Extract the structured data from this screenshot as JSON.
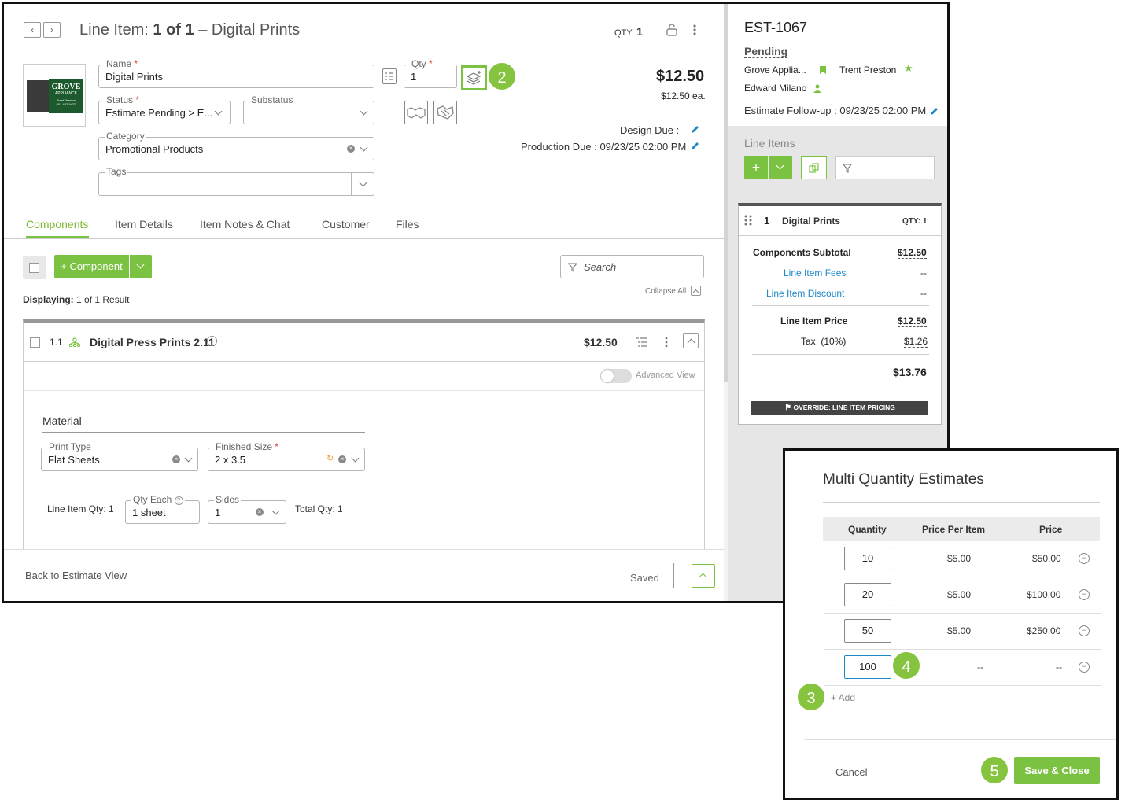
{
  "header": {
    "title_prefix": "Line Item:",
    "title_counter": "1 of 1",
    "title_dash": "–",
    "title_name": "Digital Prints",
    "qty_label": "QTY:",
    "qty_value": "1",
    "prev_icon": "chevron-left-icon",
    "next_icon": "chevron-right-icon"
  },
  "form": {
    "name": {
      "label": "Name",
      "value": "Digital Prints"
    },
    "qty": {
      "label": "Qty",
      "value": "1"
    },
    "status": {
      "label": "Status",
      "value": "Estimate Pending > E..."
    },
    "substatus": {
      "label": "Substatus",
      "value": ""
    },
    "category": {
      "label": "Category",
      "value": "Promotional Products"
    },
    "tags": {
      "label": "Tags",
      "value": ""
    },
    "required_mark": "*"
  },
  "thumbnail": {
    "brand": "GROVE",
    "sub": "APPLIANCE",
    "line1": "Trent Preston",
    "line2": "801-437-9422"
  },
  "pricing": {
    "price": "$12.50",
    "each": "$12.50 ea.",
    "design_due": "Design Due : --",
    "production_due": "Production Due : 09/23/25 02:00 PM"
  },
  "tabs": [
    "Components",
    "Item Details",
    "Item Notes & Chat",
    "Customer",
    "Files"
  ],
  "components": {
    "add_label": "+ Component",
    "search_placeholder": "Search",
    "displaying_label": "Displaying:",
    "displaying_value": "1 of 1 Result",
    "collapse_all": "Collapse All",
    "item": {
      "num": "1.1",
      "name": "Digital Press Prints 2.11",
      "price": "$12.50"
    },
    "advanced_view": "Advanced View"
  },
  "material": {
    "heading": "Material",
    "print_type": {
      "label": "Print Type",
      "value": "Flat Sheets"
    },
    "finished_size": {
      "label": "Finished Size",
      "value": "2 x 3.5"
    },
    "line_item_qty": "Line Item Qty: 1",
    "qty_each": {
      "label": "Qty Each",
      "value": "1 sheet"
    },
    "sides": {
      "label": "Sides",
      "value": "1"
    },
    "total_qty": "Total Qty: 1"
  },
  "footer": {
    "back": "Back to Estimate View",
    "saved": "Saved"
  },
  "estimate": {
    "id": "EST-1067",
    "status": "Pending",
    "company": "Grove Applia...",
    "contact": "Trent Preston",
    "salesperson": "Edward Milano",
    "followup": "Estimate Follow-up : 09/23/25 02:00 PM"
  },
  "line_items": {
    "heading": "Line Items",
    "card": {
      "num": "1",
      "name": "Digital Prints",
      "qty": "QTY: 1"
    },
    "rows": [
      {
        "label": "Components Subtotal",
        "value": "$12.50"
      },
      {
        "label": "Line Item Fees",
        "value": "--"
      },
      {
        "label": "Line Item Discount",
        "value": "--"
      },
      {
        "label": "Line Item Price",
        "value": "$12.50"
      },
      {
        "label": "Tax  (10%)",
        "value": "$1.26"
      }
    ],
    "total": "$13.76",
    "override": "OVERRIDE: LINE ITEM PRICING"
  },
  "modal": {
    "title": "Multi Quantity Estimates",
    "headers": [
      "Quantity",
      "Price Per Item",
      "Price"
    ],
    "rows": [
      {
        "qty": "10",
        "ppi": "$5.00",
        "price": "$50.00"
      },
      {
        "qty": "20",
        "ppi": "$5.00",
        "price": "$100.00"
      },
      {
        "qty": "50",
        "ppi": "$5.00",
        "price": "$250.00"
      },
      {
        "qty": "100",
        "ppi": "--",
        "price": "--"
      }
    ],
    "add": "+ Add",
    "cancel": "Cancel",
    "save": "Save & Close"
  },
  "badges": [
    "2",
    "3",
    "4",
    "5"
  ],
  "colors": {
    "accent": "#7cc242",
    "link": "#1e88c7",
    "badge": "#86c440"
  }
}
